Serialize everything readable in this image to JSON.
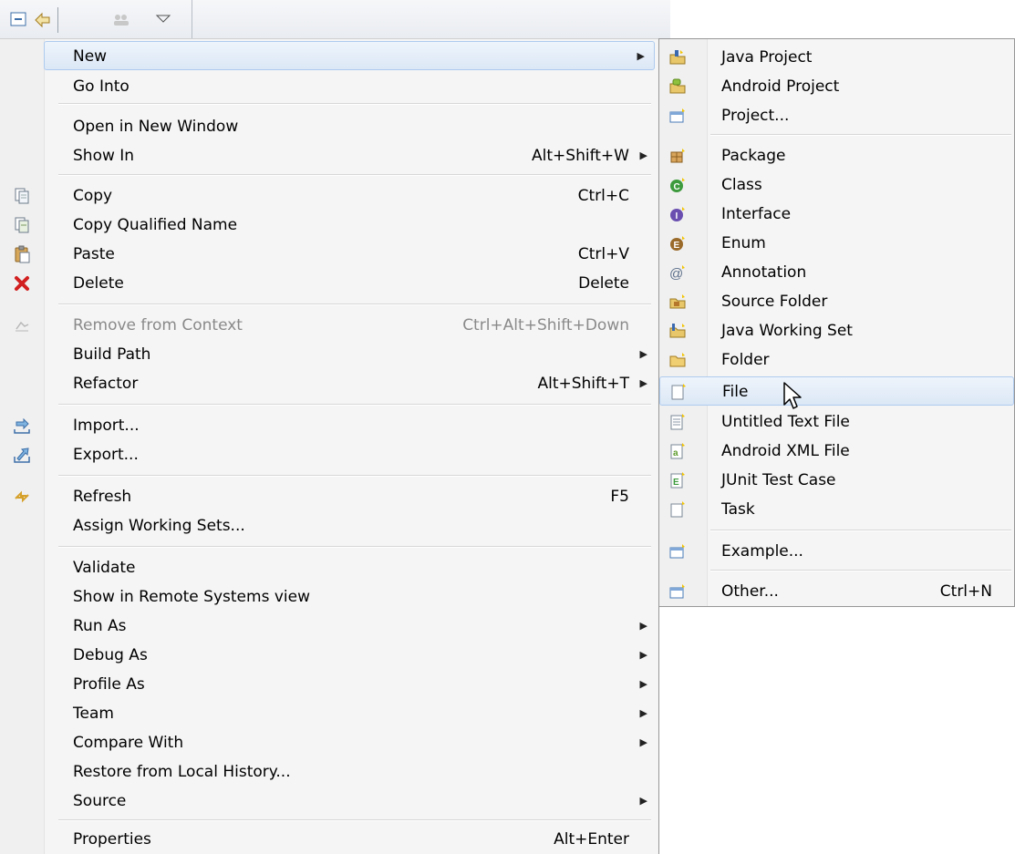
{
  "menu": {
    "items": [
      {
        "label": "New",
        "accel": "",
        "submenu": true,
        "icon": "",
        "highlight": true
      },
      {
        "label": "Go Into",
        "accel": "",
        "submenu": false,
        "icon": ""
      },
      {
        "label": "Open in New Window",
        "accel": "",
        "submenu": false,
        "icon": ""
      },
      {
        "label": "Show In",
        "accel": "Alt+Shift+W",
        "submenu": true,
        "icon": ""
      },
      {
        "label": "Copy",
        "accel": "Ctrl+C",
        "submenu": false,
        "icon": "copy-icon"
      },
      {
        "label": "Copy Qualified Name",
        "accel": "",
        "submenu": false,
        "icon": "copy-qualified-name-icon"
      },
      {
        "label": "Paste",
        "accel": "Ctrl+V",
        "submenu": false,
        "icon": "paste-icon"
      },
      {
        "label": "Delete",
        "accel": "Delete",
        "submenu": false,
        "icon": "delete-icon"
      },
      {
        "label": "Remove from Context",
        "accel": "Ctrl+Alt+Shift+Down",
        "submenu": false,
        "icon": "remove-context-icon",
        "disabled": true
      },
      {
        "label": "Build Path",
        "accel": "",
        "submenu": true,
        "icon": ""
      },
      {
        "label": "Refactor",
        "accel": "Alt+Shift+T",
        "submenu": true,
        "icon": ""
      },
      {
        "label": "Import...",
        "accel": "",
        "submenu": false,
        "icon": "import-icon"
      },
      {
        "label": "Export...",
        "accel": "",
        "submenu": false,
        "icon": "export-icon"
      },
      {
        "label": "Refresh",
        "accel": "F5",
        "submenu": false,
        "icon": "refresh-icon"
      },
      {
        "label": "Assign Working Sets...",
        "accel": "",
        "submenu": false,
        "icon": ""
      },
      {
        "label": "Validate",
        "accel": "",
        "submenu": false,
        "icon": ""
      },
      {
        "label": "Show in Remote Systems view",
        "accel": "",
        "submenu": false,
        "icon": ""
      },
      {
        "label": "Run As",
        "accel": "",
        "submenu": true,
        "icon": ""
      },
      {
        "label": "Debug As",
        "accel": "",
        "submenu": true,
        "icon": ""
      },
      {
        "label": "Profile As",
        "accel": "",
        "submenu": true,
        "icon": ""
      },
      {
        "label": "Team",
        "accel": "",
        "submenu": true,
        "icon": ""
      },
      {
        "label": "Compare With",
        "accel": "",
        "submenu": true,
        "icon": ""
      },
      {
        "label": "Restore from Local History...",
        "accel": "",
        "submenu": false,
        "icon": ""
      },
      {
        "label": "Source",
        "accel": "",
        "submenu": true,
        "icon": ""
      },
      {
        "label": "Properties",
        "accel": "Alt+Enter",
        "submenu": false,
        "icon": ""
      }
    ]
  },
  "submenu": {
    "items": [
      {
        "label": "Java Project",
        "accel": "",
        "icon": "java-project-icon"
      },
      {
        "label": "Android Project",
        "accel": "",
        "icon": "android-project-icon"
      },
      {
        "label": "Project...",
        "accel": "",
        "icon": "new-project-icon"
      },
      {
        "label": "Package",
        "accel": "",
        "icon": "package-icon"
      },
      {
        "label": "Class",
        "accel": "",
        "icon": "class-icon"
      },
      {
        "label": "Interface",
        "accel": "",
        "icon": "interface-icon"
      },
      {
        "label": "Enum",
        "accel": "",
        "icon": "enum-icon"
      },
      {
        "label": "Annotation",
        "accel": "",
        "icon": "annotation-icon"
      },
      {
        "label": "Source Folder",
        "accel": "",
        "icon": "source-folder-icon"
      },
      {
        "label": "Java Working Set",
        "accel": "",
        "icon": "java-working-set-icon"
      },
      {
        "label": "Folder",
        "accel": "",
        "icon": "folder-icon"
      },
      {
        "label": "File",
        "accel": "",
        "icon": "file-icon",
        "highlight": true
      },
      {
        "label": "Untitled Text File",
        "accel": "",
        "icon": "untitled-text-file-icon"
      },
      {
        "label": "Android XML File",
        "accel": "",
        "icon": "android-xml-file-icon"
      },
      {
        "label": "JUnit Test Case",
        "accel": "",
        "icon": "junit-test-case-icon"
      },
      {
        "label": "Task",
        "accel": "",
        "icon": "task-icon"
      },
      {
        "label": "Example...",
        "accel": "",
        "icon": "example-icon"
      },
      {
        "label": "Other...",
        "accel": "Ctrl+N",
        "icon": "other-icon"
      }
    ]
  },
  "toolbar": {
    "icons": [
      "collapse-all-icon",
      "link-with-editor-icon",
      "working-set-icon",
      "view-menu-icon"
    ]
  },
  "colors": {
    "menu_bg": "#f5f5f5",
    "highlight_border": "#aecbee",
    "highlight_bg": "#dce8f6",
    "disabled_text": "#8a8a8a"
  }
}
